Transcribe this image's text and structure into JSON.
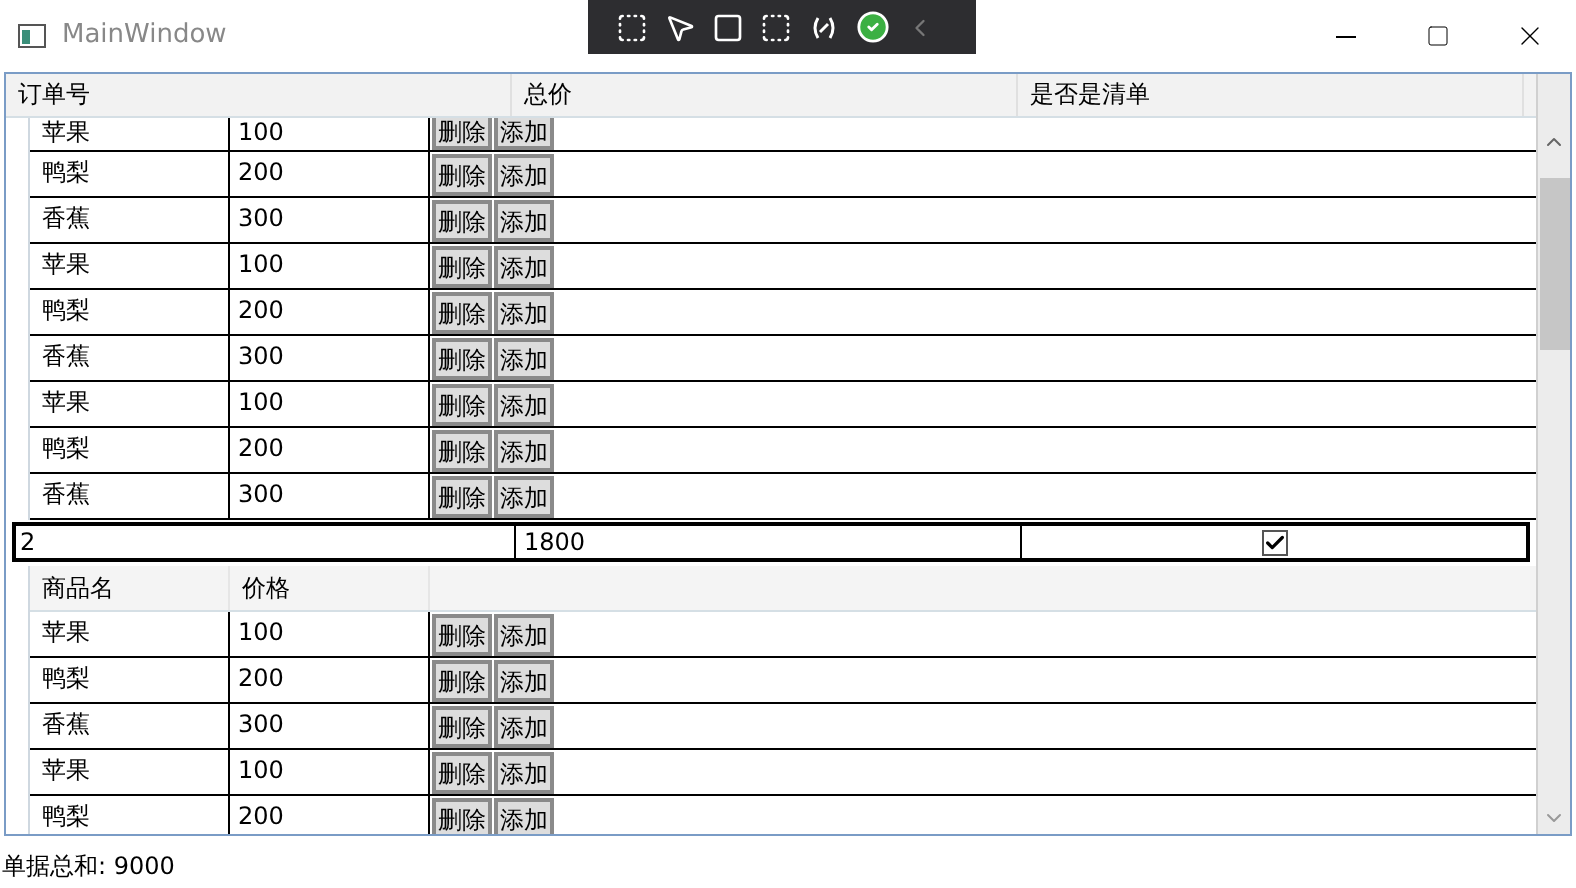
{
  "window": {
    "title": "MainWindow"
  },
  "columns": [
    "订单号",
    "总价",
    "是否是清单"
  ],
  "orders": [
    {
      "items": [
        {
          "name": "苹果",
          "price": "100",
          "buttons": [
            "删除",
            "添加"
          ]
        },
        {
          "name": "鸭梨",
          "price": "200",
          "buttons": [
            "删除",
            "添加"
          ]
        },
        {
          "name": "香蕉",
          "price": "300",
          "buttons": [
            "删除",
            "添加"
          ]
        },
        {
          "name": "苹果",
          "price": "100",
          "buttons": [
            "删除",
            "添加"
          ]
        },
        {
          "name": "鸭梨",
          "price": "200",
          "buttons": [
            "删除",
            "添加"
          ]
        },
        {
          "name": "香蕉",
          "price": "300",
          "buttons": [
            "删除",
            "添加"
          ]
        },
        {
          "name": "苹果",
          "price": "100",
          "buttons": [
            "删除",
            "添加"
          ]
        },
        {
          "name": "鸭梨",
          "price": "200",
          "buttons": [
            "删除",
            "添加"
          ]
        },
        {
          "name": "香蕉",
          "price": "300",
          "buttons": [
            "删除",
            "添加"
          ]
        }
      ]
    },
    {
      "id": "2",
      "total": "1800",
      "checked": true,
      "item_columns": [
        "商品名",
        "价格"
      ],
      "items": [
        {
          "name": "苹果",
          "price": "100",
          "buttons": [
            "删除",
            "添加"
          ]
        },
        {
          "name": "鸭梨",
          "price": "200",
          "buttons": [
            "删除",
            "添加"
          ]
        },
        {
          "name": "香蕉",
          "price": "300",
          "buttons": [
            "删除",
            "添加"
          ]
        },
        {
          "name": "苹果",
          "price": "100",
          "buttons": [
            "删除",
            "添加"
          ]
        },
        {
          "name": "鸭梨",
          "price": "200",
          "buttons": [
            "删除",
            "添加"
          ]
        }
      ]
    }
  ],
  "footer": "单据总和: 9000"
}
